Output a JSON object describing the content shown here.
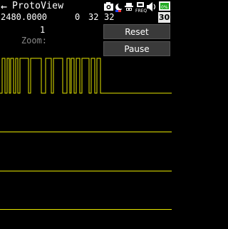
{
  "app": {
    "title": "ProtoView",
    "back_glyph": "←"
  },
  "readout": {
    "frequency": "2480.0000",
    "value1": "0",
    "value2": "32",
    "value3": "32"
  },
  "zoom": {
    "label": "Zoom:",
    "value": "1"
  },
  "status_bar": {
    "icons": [
      "camera-icon",
      "moon-icon",
      "hat-icon",
      "freq-icon",
      "speaker-icon",
      "battery-icon"
    ],
    "freq_label": "FREQ",
    "battery_value": "30",
    "battery_color": "#22aa22"
  },
  "buttons": {
    "reset_label": "Reset",
    "pause_label": "Pause"
  },
  "colors": {
    "background": "#000000",
    "signal": "#e6e600",
    "text": "#ffffff",
    "zoom_label": "#888888",
    "button_bg": "#3a3a3a"
  }
}
